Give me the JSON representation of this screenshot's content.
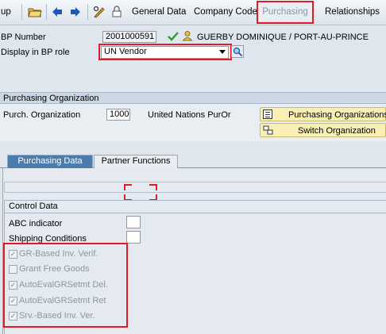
{
  "toolbar": {
    "partial_label": "up",
    "general_data": "General Data",
    "company_code": "Company Code",
    "purchasing": "Purchasing",
    "relationships": "Relationships"
  },
  "header": {
    "bp_number_label": "BP Number",
    "bp_number_value": "2001000591",
    "bp_name": "GUERBY DOMINIQUE / PORT-AU-PRINCE",
    "role_label": "Display in BP role",
    "role_value": "UN Vendor"
  },
  "purch_org_section": {
    "title": "Purchasing Organization",
    "label": "Purch. Organization",
    "value": "1000",
    "description": "United Nations PurOr",
    "btn_purch_orgs": "Purchasing Organizations",
    "btn_switch_org": "Switch Organization"
  },
  "tabs": [
    {
      "label": "Purchasing Data"
    },
    {
      "label": "Partner Functions"
    }
  ],
  "control_data": {
    "title": "Control Data",
    "abc_indicator_label": "ABC indicator",
    "shipping_conditions_label": "Shipping Conditions",
    "checkboxes": [
      {
        "label": "GR-Based Inv. Verif."
      },
      {
        "label": "Grant Free Goods"
      },
      {
        "label": "AutoEvalGRSetmt Del."
      },
      {
        "label": "AutoEvalGRSetmt Ret"
      },
      {
        "label": "Srv.-Based Inv. Ver."
      }
    ]
  },
  "colors": {
    "highlight": "#e01b24",
    "button_yellow": "#f7efb4",
    "check_green": "#2e9a2e"
  }
}
